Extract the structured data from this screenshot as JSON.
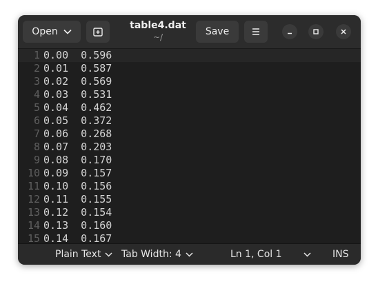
{
  "header": {
    "open_label": "Open",
    "title": "table4.dat",
    "subtitle": "~/",
    "save_label": "Save"
  },
  "icons": {
    "open_dropdown": "chevron-down-icon",
    "new_tab": "new-tab-icon",
    "menu": "hamburger-menu-icon",
    "minimize": "minimize-icon",
    "maximize": "maximize-icon",
    "close": "close-icon"
  },
  "editor": {
    "current_line": 1,
    "lines": [
      {
        "number": "1",
        "text": "0.00  0.596"
      },
      {
        "number": "2",
        "text": "0.01  0.587"
      },
      {
        "number": "3",
        "text": "0.02  0.569"
      },
      {
        "number": "4",
        "text": "0.03  0.531"
      },
      {
        "number": "5",
        "text": "0.04  0.462"
      },
      {
        "number": "6",
        "text": "0.05  0.372"
      },
      {
        "number": "7",
        "text": "0.06  0.268"
      },
      {
        "number": "8",
        "text": "0.07  0.203"
      },
      {
        "number": "9",
        "text": "0.08  0.170"
      },
      {
        "number": "10",
        "text": "0.09  0.157"
      },
      {
        "number": "11",
        "text": "0.10  0.156"
      },
      {
        "number": "12",
        "text": "0.11  0.155"
      },
      {
        "number": "13",
        "text": "0.12  0.154"
      },
      {
        "number": "14",
        "text": "0.13  0.160"
      },
      {
        "number": "15",
        "text": "0.14  0.167"
      }
    ]
  },
  "status": {
    "language": "Plain Text",
    "tab_width": "Tab Width: 4",
    "position": "Ln 1, Col 1",
    "mode": "INS"
  },
  "colors": {
    "editor_bg": "#1e1e1e",
    "header_bg": "#2c2c2c",
    "text": "#d4d4d4",
    "line_number": "#5f5f5f"
  }
}
